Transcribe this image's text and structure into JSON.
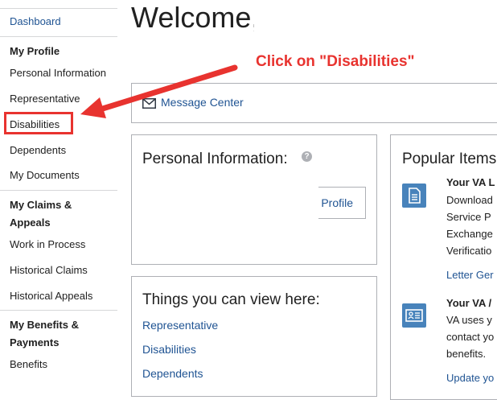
{
  "sidebar": {
    "dashboard": "Dashboard",
    "my_profile_heading": "My Profile",
    "personal_information": "Personal Information",
    "representative": "Representative",
    "disabilities": "Disabilities",
    "dependents": "Dependents",
    "my_documents": "My Documents",
    "claims_heading_line1": "My Claims &",
    "claims_heading_line2": "Appeals",
    "work_in_process": "Work in Process",
    "historical_claims": "Historical Claims",
    "historical_appeals": "Historical Appeals",
    "benefits_heading_line1": "My Benefits &",
    "benefits_heading_line2": "Payments",
    "benefits": "Benefits"
  },
  "header": {
    "welcome": "Welcome,"
  },
  "annotation": {
    "callout": "Click on \"Disabilities\"",
    "color": "#e8332f"
  },
  "message_center": {
    "label": "Message Center",
    "icon": "envelope-icon"
  },
  "personal_info": {
    "title": "Personal Information:",
    "help_icon": "question-circle-icon",
    "edit_button": "dit Profile"
  },
  "things": {
    "title": "Things you can view here:",
    "links": [
      "Representative",
      "Disabilities",
      "Dependents"
    ]
  },
  "popular": {
    "title": "Popular Items",
    "item1": {
      "icon": "document-icon",
      "title": "Your VA L",
      "lines": [
        "Download",
        "Service P",
        "Exchange",
        "Verificatio"
      ],
      "link": "Letter Ger"
    },
    "item2": {
      "icon": "id-card-icon",
      "title": "Your VA /",
      "lines": [
        "VA uses y",
        "contact yo",
        "benefits."
      ],
      "link": "Update yo"
    }
  },
  "colors": {
    "link": "#205493",
    "accent_red": "#e8332f",
    "icon_blue": "#4883bb",
    "border": "#aeb0b5"
  }
}
